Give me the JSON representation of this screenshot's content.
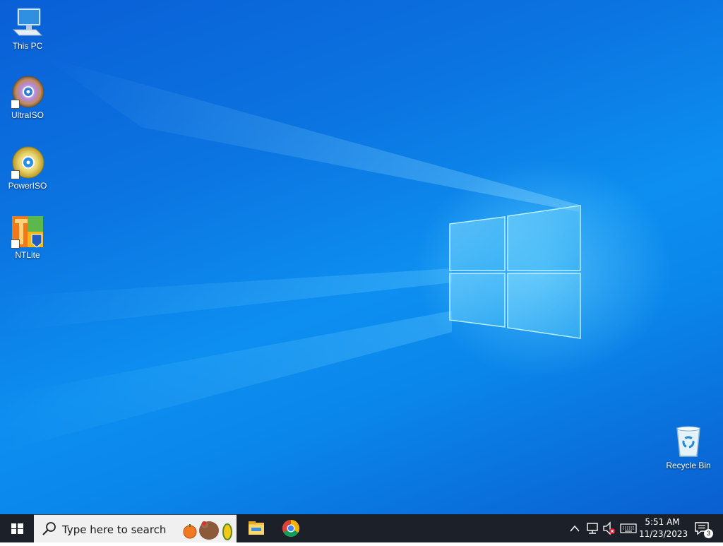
{
  "desktop": {
    "icons": [
      {
        "label": "This PC",
        "icon": "computer-icon"
      },
      {
        "label": "UltraISO",
        "icon": "disc-icon"
      },
      {
        "label": "PowerISO",
        "icon": "disc-gold-icon"
      },
      {
        "label": "NTLite",
        "icon": "ntlite-icon"
      },
      {
        "label": "Recycle Bin",
        "icon": "recycle-bin-icon"
      }
    ]
  },
  "taskbar": {
    "search_placeholder": "Type here to search",
    "pinned": [
      {
        "name": "File Explorer",
        "icon": "folder-icon"
      },
      {
        "name": "Google Chrome",
        "icon": "chrome-icon"
      }
    ],
    "tray": {
      "time": "5:51 AM",
      "date": "11/23/2023",
      "notification_count": "3"
    }
  },
  "colors": {
    "taskbar_bg": "#1c2129",
    "search_bg": "#f0f0f0",
    "desktop_blue": "#0b74e0"
  }
}
